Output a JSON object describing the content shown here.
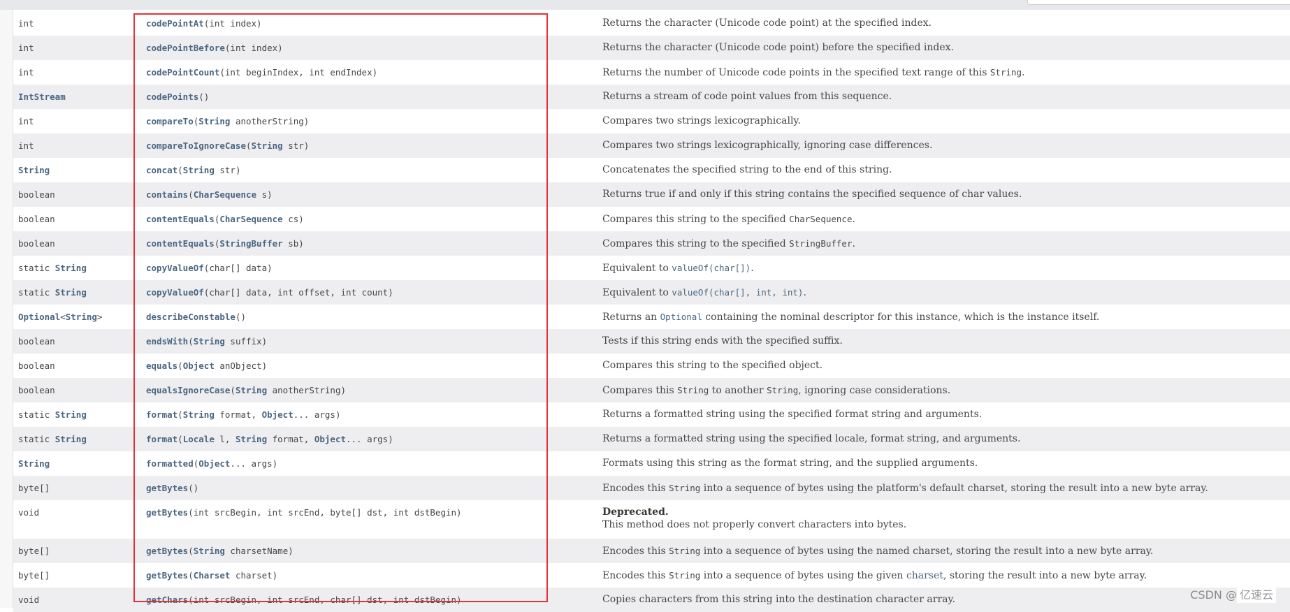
{
  "colors": {
    "link": "#4a6782",
    "highlight_box": "#e5323a",
    "row_alt": "#eeeef0"
  },
  "rows": [
    {
      "type": [
        "int"
      ],
      "method": "codePointAt",
      "params": [
        "(int index)"
      ],
      "desc": [
        "Returns the character (Unicode code point) at the specified index."
      ]
    },
    {
      "type": [
        "int"
      ],
      "method": "codePointBefore",
      "params": [
        "(int index)"
      ],
      "desc": [
        "Returns the character (Unicode code point) before the specified index."
      ]
    },
    {
      "type": [
        "int"
      ],
      "method": "codePointCount",
      "params": [
        "(int beginIndex, int endIndex)"
      ],
      "desc": [
        "Returns the number of Unicode code points in the specified text range of this ",
        {
          "code": "String"
        },
        "."
      ]
    },
    {
      "type": [
        {
          "link": "IntStream"
        }
      ],
      "method": "codePoints",
      "params": [
        "()"
      ],
      "desc": [
        "Returns a stream of code point values from this sequence."
      ]
    },
    {
      "type": [
        "int"
      ],
      "method": "compareTo",
      "params": [
        "(",
        {
          "link": "String"
        },
        " anotherString)"
      ],
      "desc": [
        "Compares two strings lexicographically."
      ]
    },
    {
      "type": [
        "int"
      ],
      "method": "compareToIgnoreCase",
      "params": [
        "(",
        {
          "link": "String"
        },
        " str)"
      ],
      "desc": [
        "Compares two strings lexicographically, ignoring case differences."
      ]
    },
    {
      "type": [
        {
          "link": "String"
        }
      ],
      "method": "concat",
      "params": [
        "(",
        {
          "link": "String"
        },
        " str)"
      ],
      "desc": [
        "Concatenates the specified string to the end of this string."
      ]
    },
    {
      "type": [
        "boolean"
      ],
      "method": "contains",
      "params": [
        "(",
        {
          "link": "CharSequence"
        },
        " s)"
      ],
      "desc": [
        "Returns true if and only if this string contains the specified sequence of char values."
      ]
    },
    {
      "type": [
        "boolean"
      ],
      "method": "contentEquals",
      "params": [
        "(",
        {
          "link": "CharSequence"
        },
        " cs)"
      ],
      "desc": [
        "Compares this string to the specified ",
        {
          "code": "CharSequence"
        },
        "."
      ]
    },
    {
      "type": [
        "boolean"
      ],
      "method": "contentEquals",
      "params": [
        "(",
        {
          "link": "StringBuffer"
        },
        " sb)"
      ],
      "desc": [
        "Compares this string to the specified ",
        {
          "code": "StringBuffer"
        },
        "."
      ]
    },
    {
      "type": [
        "static ",
        {
          "link": "String"
        }
      ],
      "method": "copyValueOf",
      "params": [
        "(char[] data)"
      ],
      "desc": [
        "Equivalent to ",
        {
          "codelink": "valueOf(char[])"
        },
        "."
      ]
    },
    {
      "type": [
        "static ",
        {
          "link": "String"
        }
      ],
      "method": "copyValueOf",
      "params": [
        "(char[] data, int offset, int count)"
      ],
      "desc": [
        "Equivalent to ",
        {
          "codelink": "valueOf(char[], int, int)"
        },
        "."
      ]
    },
    {
      "type": [
        {
          "link": "Optional"
        },
        "<",
        {
          "link": "String"
        },
        ">"
      ],
      "method": "describeConstable",
      "params": [
        "()"
      ],
      "desc": [
        "Returns an ",
        {
          "codelink": "Optional"
        },
        " containing the nominal descriptor for this instance, which is the instance itself."
      ]
    },
    {
      "type": [
        "boolean"
      ],
      "method": "endsWith",
      "params": [
        "(",
        {
          "link": "String"
        },
        " suffix)"
      ],
      "desc": [
        "Tests if this string ends with the specified suffix."
      ]
    },
    {
      "type": [
        "boolean"
      ],
      "method": "equals",
      "params": [
        "(",
        {
          "link": "Object"
        },
        " anObject)"
      ],
      "desc": [
        "Compares this string to the specified object."
      ]
    },
    {
      "type": [
        "boolean"
      ],
      "method": "equalsIgnoreCase",
      "params": [
        "(",
        {
          "link": "String"
        },
        " anotherString)"
      ],
      "desc": [
        "Compares this ",
        {
          "code": "String"
        },
        " to another ",
        {
          "code": "String"
        },
        ", ignoring case considerations."
      ]
    },
    {
      "type": [
        "static ",
        {
          "link": "String"
        }
      ],
      "method": "format",
      "params": [
        "(",
        {
          "link": "String"
        },
        " format, ",
        {
          "link": "Object"
        },
        "... args)"
      ],
      "desc": [
        "Returns a formatted string using the specified format string and arguments."
      ]
    },
    {
      "type": [
        "static ",
        {
          "link": "String"
        }
      ],
      "method": "format",
      "params": [
        "(",
        {
          "link": "Locale"
        },
        " l, ",
        {
          "link": "String"
        },
        " format, ",
        {
          "link": "Object"
        },
        "... args)"
      ],
      "desc": [
        "Returns a formatted string using the specified locale, format string, and arguments."
      ]
    },
    {
      "type": [
        {
          "link": "String"
        }
      ],
      "method": "formatted",
      "params": [
        "(",
        {
          "link": "Object"
        },
        "... args)"
      ],
      "desc": [
        "Formats using this string as the format string, and the supplied arguments."
      ]
    },
    {
      "type": [
        "byte[]"
      ],
      "method": "getBytes",
      "params": [
        "()"
      ],
      "desc": [
        "Encodes this ",
        {
          "code": "String"
        },
        " into a sequence of bytes using the platform's default charset, storing the result into a new byte array."
      ]
    },
    {
      "type": [
        "void"
      ],
      "method": "getBytes",
      "params": [
        "(int srcBegin, int srcEnd, byte[] dst, int dstBegin)"
      ],
      "tall": true,
      "desc": [
        {
          "bold": "Deprecated."
        },
        {
          "br": "This method does not properly convert characters into bytes."
        }
      ]
    },
    {
      "type": [
        "byte[]"
      ],
      "method": "getBytes",
      "params": [
        "(",
        {
          "link": "String"
        },
        " charsetName)"
      ],
      "desc": [
        "Encodes this ",
        {
          "code": "String"
        },
        " into a sequence of bytes using the named charset, storing the result into a new byte array."
      ]
    },
    {
      "type": [
        "byte[]"
      ],
      "method": "getBytes",
      "params": [
        "(",
        {
          "link": "Charset"
        },
        " charset)"
      ],
      "desc": [
        "Encodes this ",
        {
          "code": "String"
        },
        " into a sequence of bytes using the given ",
        {
          "plainlink": "charset"
        },
        ", storing the result into a new byte array."
      ]
    },
    {
      "type": [
        "void"
      ],
      "method": "getChars",
      "params": [
        "(int srcBegin, int srcEnd, char[] dst, int dstBegin)"
      ],
      "desc": [
        "Copies characters from this string into the destination character array."
      ]
    }
  ],
  "watermark": {
    "text": "CSDN @",
    "brand": "亿速云"
  }
}
